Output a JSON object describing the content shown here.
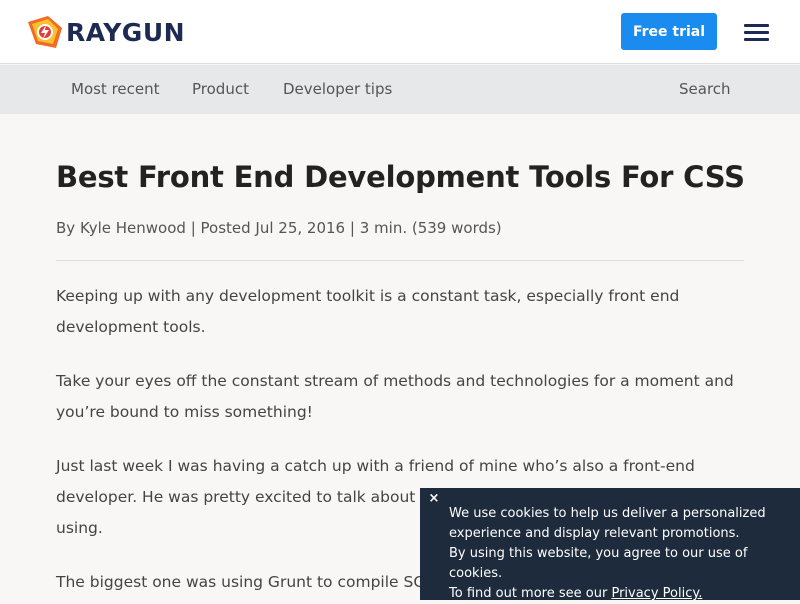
{
  "header": {
    "brand": "RAYGUN",
    "cta_label": "Free trial",
    "brand_color": "#1d2b52",
    "accent_color": "#1a8cf0",
    "logo_icon": "raygun-logo-icon",
    "menu_icon": "hamburger-menu-icon"
  },
  "subnav": {
    "items": [
      {
        "label": "Most recent"
      },
      {
        "label": "Product"
      },
      {
        "label": "Developer tips"
      }
    ],
    "search_label": "Search"
  },
  "article": {
    "title": "Best Front End Development Tools For CSS",
    "byline": {
      "prefix": "By",
      "author": "Kyle Henwood",
      "separator": "|",
      "posted": "Posted Jul 25, 2016",
      "read_time": "3 min. (539 words)"
    },
    "paragraphs": [
      "Keeping up with any development toolkit is a constant task, especially front end development tools.",
      "Take your eyes off the constant stream of methods and technologies for a moment and you’re bound to miss something!",
      "Just last week I was having a catch up with a friend of mine who’s also a front-end developer. He was pretty excited to talk about some of the new tools he had started using.",
      "The biggest one was using Grunt to compile SCSS"
    ]
  },
  "cookie_banner": {
    "close_icon": "close-icon",
    "close_symbol": "×",
    "line1": "We use cookies to help us deliver a personalized experience and display relevant promotions.",
    "line2": "By using this website, you agree to our use of cookies.",
    "line3_prefix": "To find out more see our",
    "policy_link": "Privacy Policy."
  }
}
